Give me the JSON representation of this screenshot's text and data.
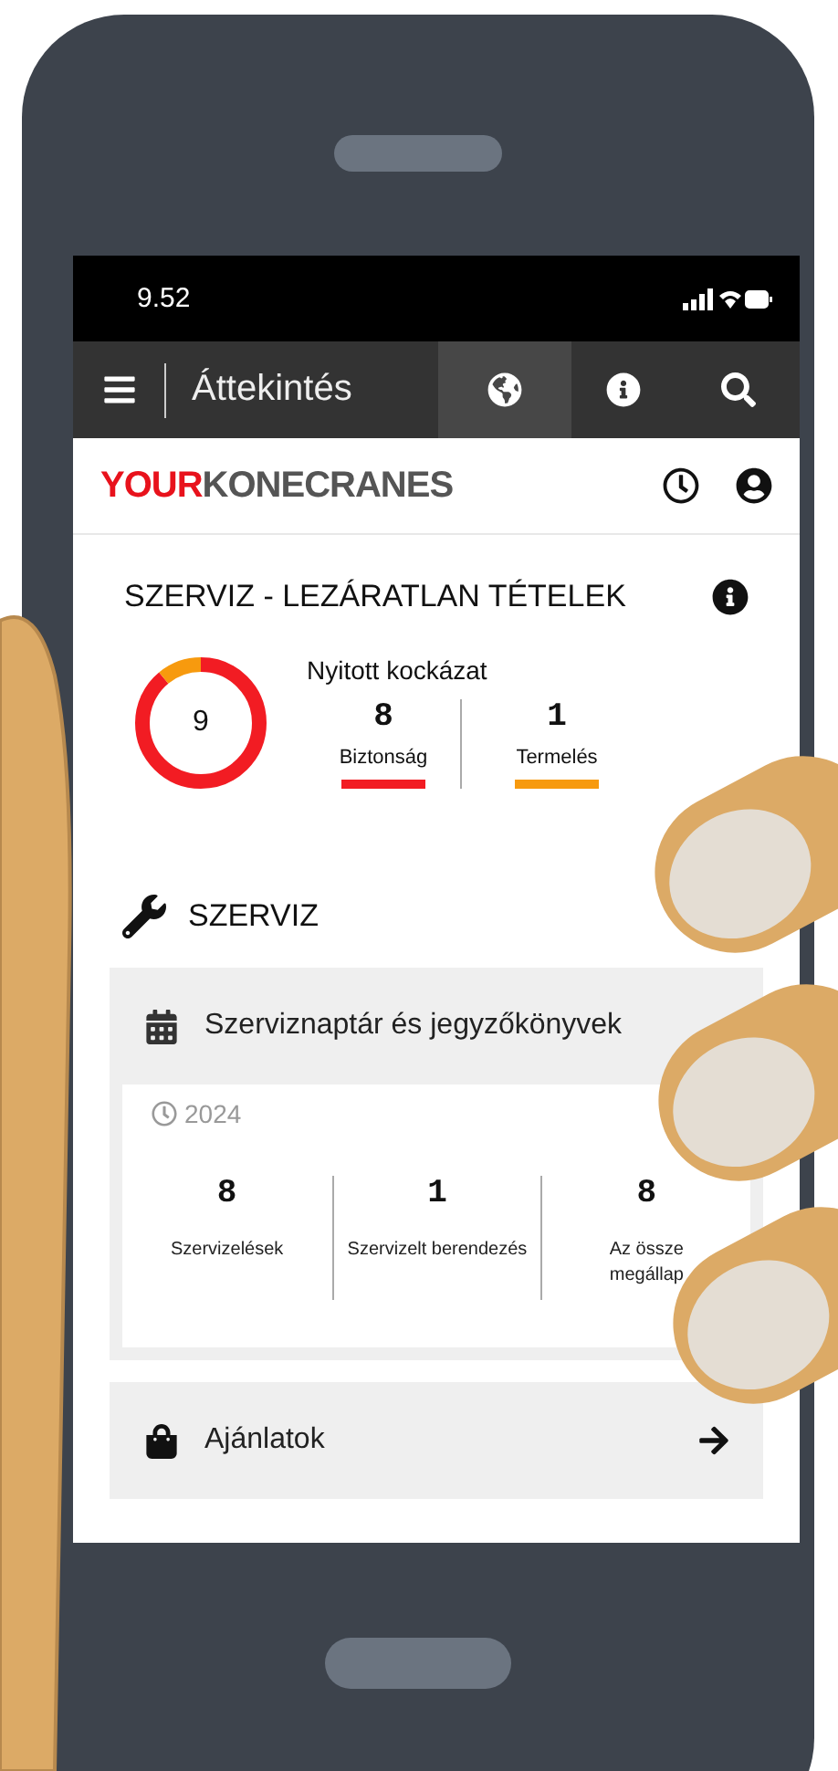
{
  "status_bar": {
    "time": "9.52"
  },
  "nav": {
    "title": "Áttekintés",
    "actions": [
      {
        "kind": "globe",
        "selected": true
      },
      {
        "kind": "info",
        "selected": false
      },
      {
        "kind": "search",
        "selected": false
      }
    ]
  },
  "brand": {
    "part_1": "YOUR",
    "part_2": "KONECRANES"
  },
  "risk_card": {
    "title": "SZERVIZ - LEZÁRATLAN TÉTELEK",
    "total": "9",
    "heading": "Nyitott kockázat",
    "stats": [
      {
        "value": "8",
        "label": "Biztonság",
        "color": "#f21c23"
      },
      {
        "value": "1",
        "label": "Termelés",
        "color": "#f79a0e"
      }
    ]
  },
  "service": {
    "title": "SZERVIZ",
    "calendar": {
      "title": "Szerviznaptár és jegyzőkönyvek",
      "year": "2024",
      "stats": [
        {
          "value": "8",
          "label_lines": [
            "Szervizelések"
          ]
        },
        {
          "value": "1",
          "label_lines": [
            "Szervizelt berendezés"
          ]
        },
        {
          "value": "8",
          "label_lines": [
            "Az össze",
            "megállap"
          ]
        }
      ]
    },
    "offers": {
      "title": "Ajánlatok"
    }
  }
}
